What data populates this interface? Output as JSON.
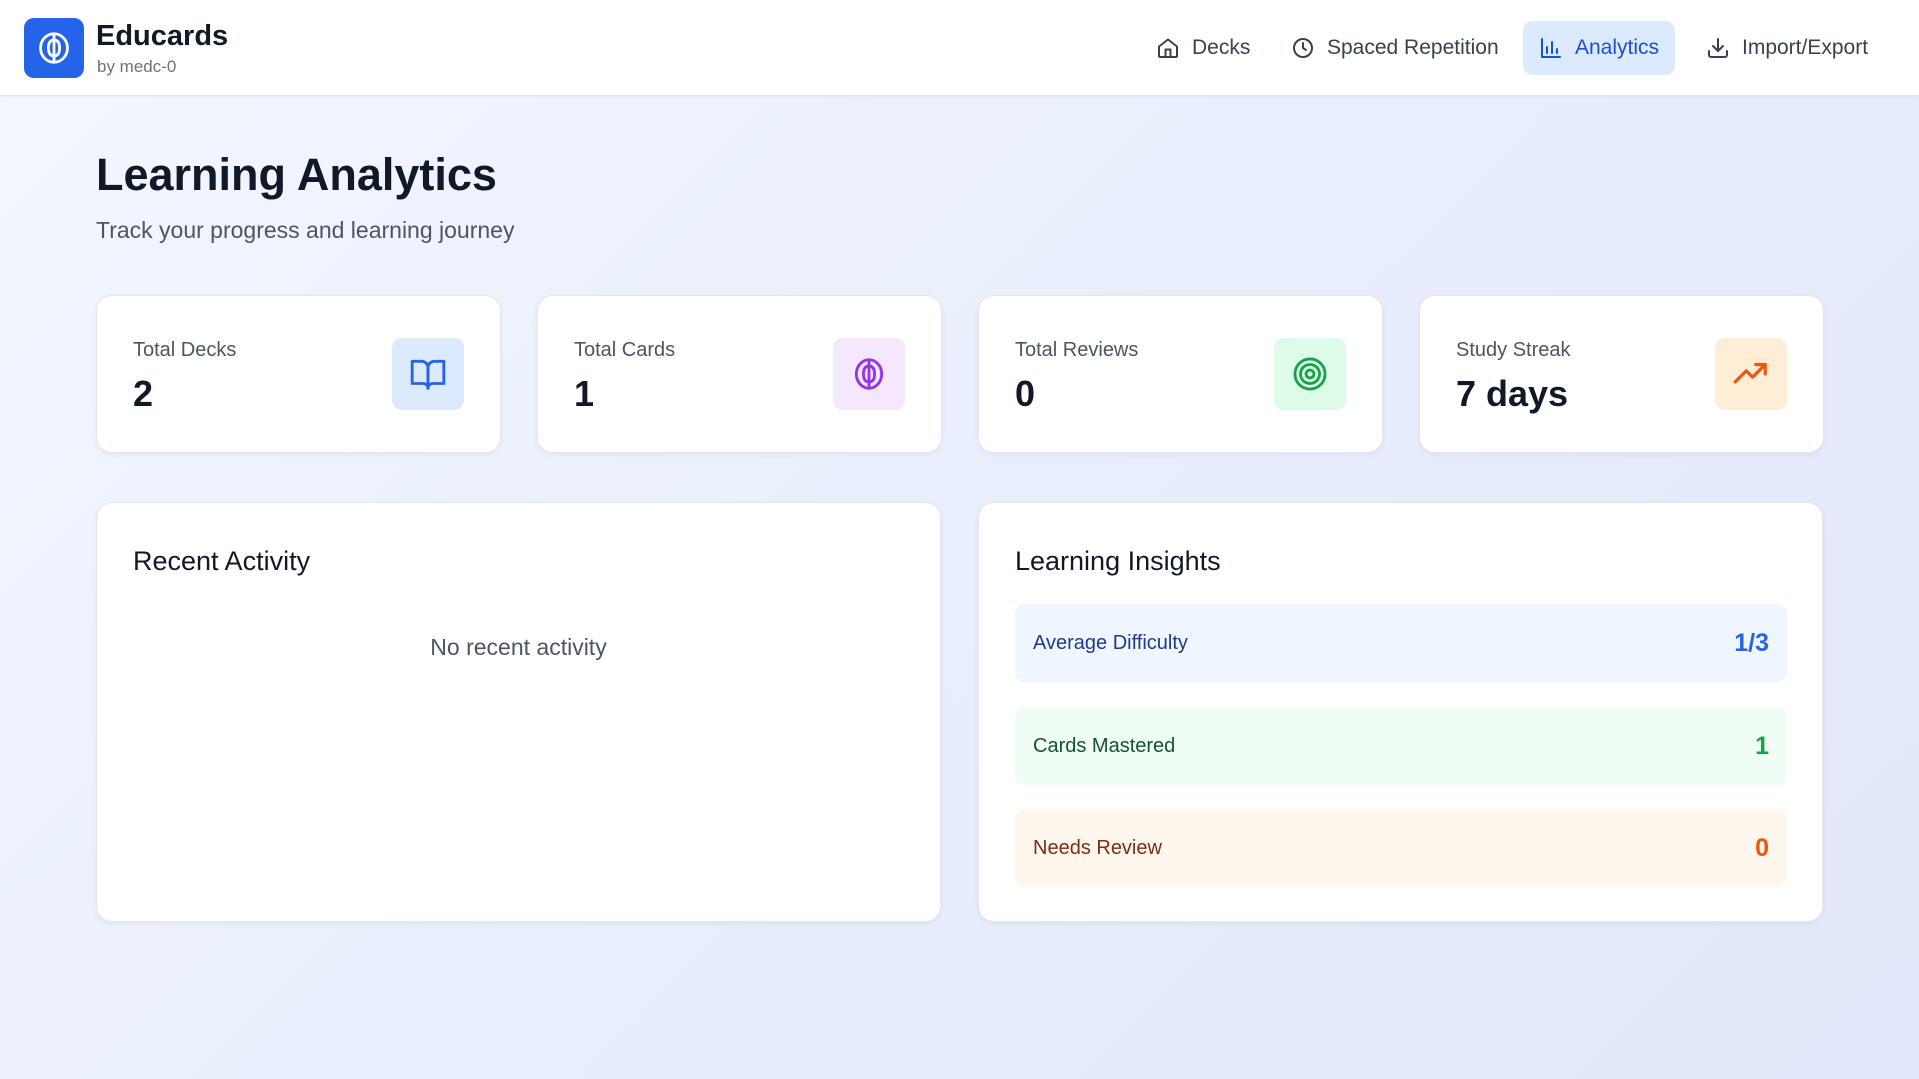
{
  "app": {
    "name": "Educards",
    "byline": "by medc-0",
    "logo_icon": "brain-icon",
    "accent_color": "#2563eb"
  },
  "nav": {
    "items": [
      {
        "label": "Decks",
        "icon": "home-icon",
        "active": false
      },
      {
        "label": "Spaced Repetition",
        "icon": "clock-icon",
        "active": false
      },
      {
        "label": "Analytics",
        "icon": "bar-chart-icon",
        "active": true
      },
      {
        "label": "Import/Export",
        "icon": "download-icon",
        "active": false
      }
    ]
  },
  "page": {
    "title": "Learning Analytics",
    "subtitle": "Track your progress and learning journey"
  },
  "stats": [
    {
      "label": "Total Decks",
      "value": "2",
      "icon": "book-open-icon",
      "icon_color": "#2563eb",
      "icon_bg": "#dbeafe"
    },
    {
      "label": "Total Cards",
      "value": "1",
      "icon": "brain-icon",
      "icon_color": "#9333ea",
      "icon_bg": "#f3e8ff"
    },
    {
      "label": "Total Reviews",
      "value": "0",
      "icon": "target-icon",
      "icon_color": "#16a34a",
      "icon_bg": "#dcfce7"
    },
    {
      "label": "Study Streak",
      "value": "7 days",
      "icon": "trending-up-icon",
      "icon_color": "#ea580c",
      "icon_bg": "#ffedd5"
    }
  ],
  "recent_activity": {
    "title": "Recent Activity",
    "empty_text": "No recent activity"
  },
  "insights": {
    "title": "Learning Insights",
    "items": [
      {
        "label": "Average Difficulty",
        "value": "1/3",
        "bg": "#eff6ff",
        "label_color": "#1e3a8a",
        "value_color": "#2563eb"
      },
      {
        "label": "Cards Mastered",
        "value": "1",
        "bg": "#f0fdf4",
        "label_color": "#14532d",
        "value_color": "#16a34a"
      },
      {
        "label": "Needs Review",
        "value": "0",
        "bg": "#fff7ed",
        "label_color": "#7c2d12",
        "value_color": "#ea580c"
      }
    ]
  }
}
